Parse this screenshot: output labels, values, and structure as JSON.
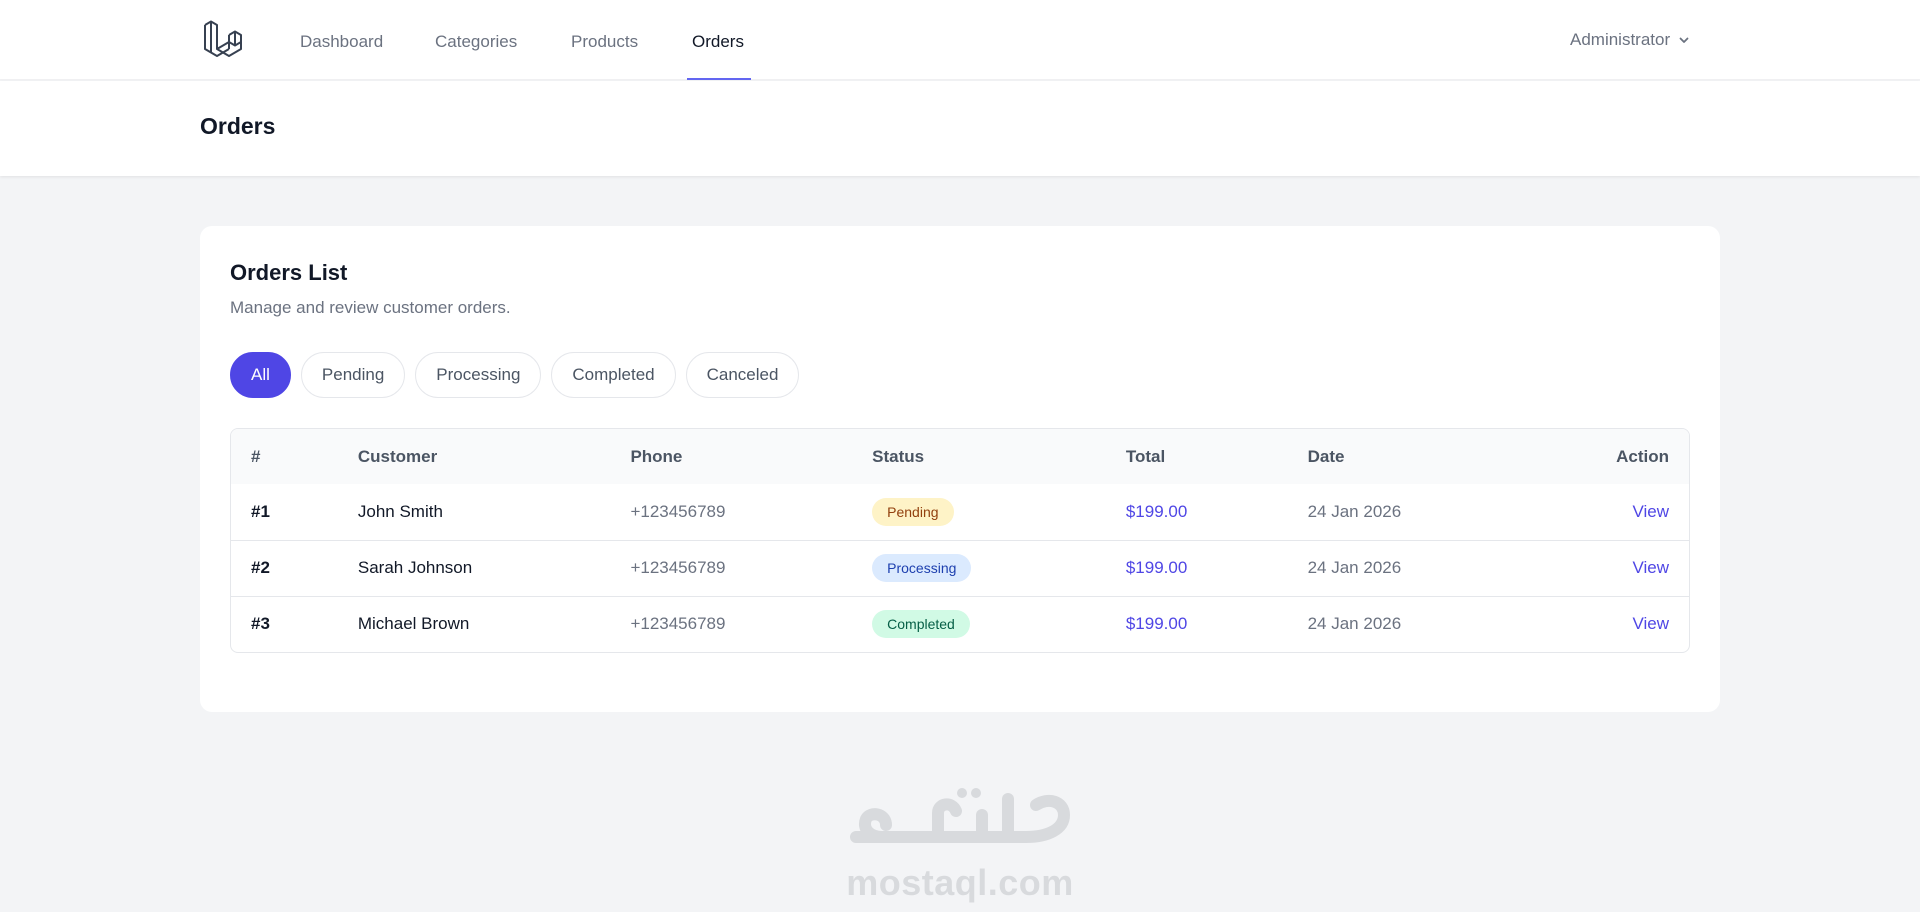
{
  "nav": {
    "links": [
      "Dashboard",
      "Categories",
      "Products",
      "Orders"
    ],
    "active": "Orders",
    "user": "Administrator"
  },
  "page": {
    "title": "Orders"
  },
  "card": {
    "title": "Orders List",
    "subtitle": "Manage and review customer orders."
  },
  "filters": [
    "All",
    "Pending",
    "Processing",
    "Completed",
    "Canceled"
  ],
  "table": {
    "headers": [
      "#",
      "Customer",
      "Phone",
      "Status",
      "Total",
      "Date",
      "Action"
    ],
    "rows": [
      {
        "id": "#1",
        "customer": "John Smith",
        "phone": "+123456789",
        "status": "Pending",
        "total": "$199.00",
        "date": "24 Jan 2026",
        "action": "View"
      },
      {
        "id": "#2",
        "customer": "Sarah Johnson",
        "phone": "+123456789",
        "status": "Processing",
        "total": "$199.00",
        "date": "24 Jan 2026",
        "action": "View"
      },
      {
        "id": "#3",
        "customer": "Michael Brown",
        "phone": "+123456789",
        "status": "Completed",
        "total": "$199.00",
        "date": "24 Jan 2026",
        "action": "View"
      }
    ]
  },
  "colors": {
    "accent": "#4f46e5",
    "nav_underline": "#6366f1",
    "pending_bg": "#fef3c7",
    "processing_bg": "#dbeafe",
    "completed_bg": "#d1fae5"
  },
  "icons": {
    "logo": "laravel-logo-icon",
    "user_menu": "chevron-down-icon"
  },
  "watermark": {
    "arabic": "مستقل",
    "latin": "mostaql.com"
  }
}
